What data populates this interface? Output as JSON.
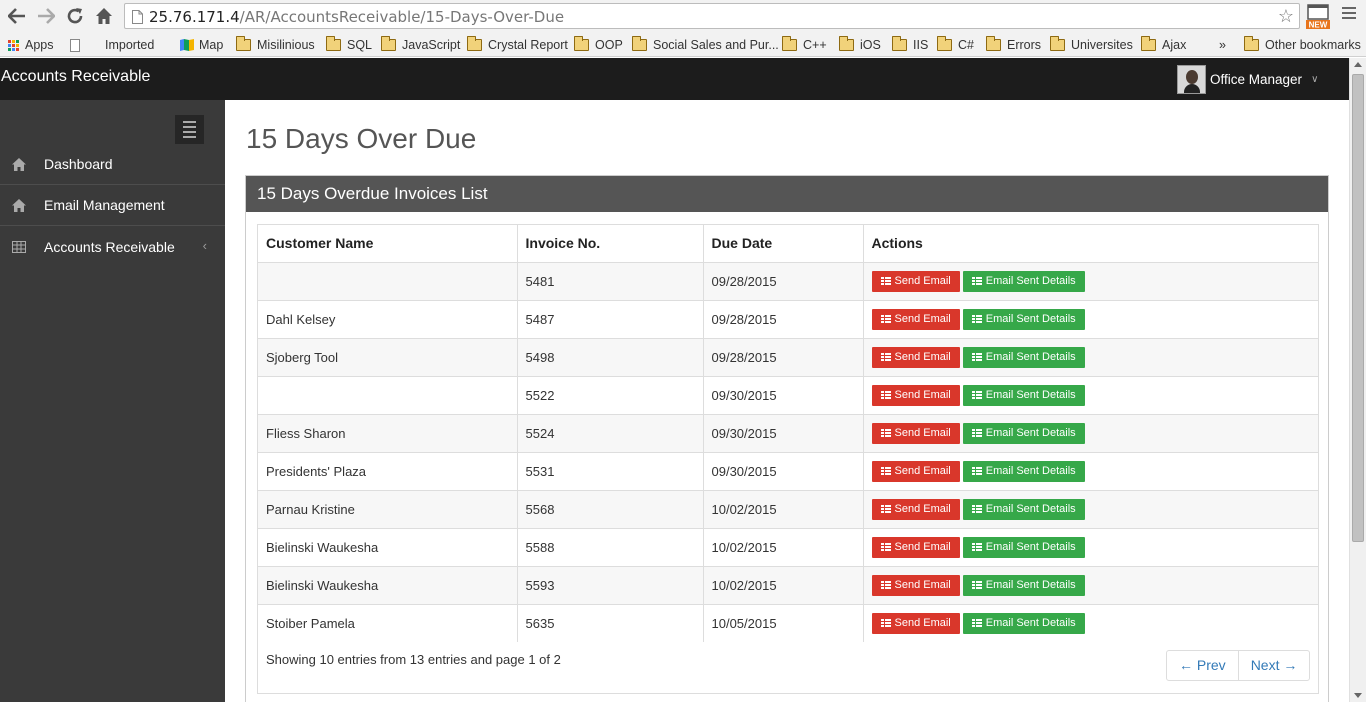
{
  "browser": {
    "url_host": "25.76.171.4",
    "url_path": "/AR/AccountsReceivable/15-Days-Over-Due",
    "bookmarks": [
      {
        "label": "Apps",
        "kind": "apps"
      },
      {
        "label": "Imported",
        "kind": "page"
      },
      {
        "label": "Map",
        "kind": "map"
      },
      {
        "label": "Misilinious",
        "kind": "folder"
      },
      {
        "label": "SQL",
        "kind": "folder"
      },
      {
        "label": "JavaScript",
        "kind": "folder"
      },
      {
        "label": "Crystal Report",
        "kind": "folder"
      },
      {
        "label": "OOP",
        "kind": "folder"
      },
      {
        "label": "Social Sales and Pur...",
        "kind": "folder"
      },
      {
        "label": "C++",
        "kind": "folder"
      },
      {
        "label": "iOS",
        "kind": "folder"
      },
      {
        "label": "IIS",
        "kind": "folder"
      },
      {
        "label": "C#",
        "kind": "folder"
      },
      {
        "label": "Errors",
        "kind": "folder"
      },
      {
        "label": "Universites",
        "kind": "folder"
      },
      {
        "label": "Ajax",
        "kind": "folder"
      }
    ],
    "more_label": "»",
    "other_bookmarks": "Other bookmarks"
  },
  "header": {
    "app_title": "Accounts Receivable",
    "user_name": "Office Manager"
  },
  "sidebar": {
    "items": [
      {
        "label": "Dashboard",
        "icon": "home-icon"
      },
      {
        "label": "Email Management",
        "icon": "home-icon"
      },
      {
        "label": "Accounts Receivable",
        "icon": "table-icon",
        "chevron": "‹"
      }
    ]
  },
  "main": {
    "page_title": "15 Days Over Due",
    "panel_title": "15 Days Overdue Invoices List",
    "columns": [
      "Customer Name",
      "Invoice No.",
      "Due Date",
      "Actions"
    ],
    "send_email_label": "Send Email",
    "email_details_label": "Email Sent Details",
    "rows": [
      {
        "customer": "",
        "invoice": "5481",
        "due": "09/28/2015"
      },
      {
        "customer": "Dahl Kelsey",
        "invoice": "5487",
        "due": "09/28/2015"
      },
      {
        "customer": "Sjoberg Tool",
        "invoice": "5498",
        "due": "09/28/2015"
      },
      {
        "customer": "",
        "invoice": "5522",
        "due": "09/30/2015"
      },
      {
        "customer": "Fliess Sharon",
        "invoice": "5524",
        "due": "09/30/2015"
      },
      {
        "customer": "Presidents' Plaza",
        "invoice": "5531",
        "due": "09/30/2015"
      },
      {
        "customer": "Parnau Kristine",
        "invoice": "5568",
        "due": "10/02/2015"
      },
      {
        "customer": "Bielinski Waukesha",
        "invoice": "5588",
        "due": "10/02/2015"
      },
      {
        "customer": "Bielinski Waukesha",
        "invoice": "5593",
        "due": "10/02/2015"
      },
      {
        "customer": "Stoiber Pamela",
        "invoice": "5635",
        "due": "10/05/2015"
      }
    ],
    "footer_info": "Showing 10 entries from 13 entries and page 1 of 2",
    "prev_label": "← Prev",
    "next_label": "Next →"
  },
  "colors": {
    "header_bg": "#1c1c1c",
    "sidebar_bg": "#3a3a3a",
    "panel_heading_bg": "#555555",
    "send_email": "#d9372b",
    "email_details": "#36a849",
    "link": "#337ab7"
  }
}
